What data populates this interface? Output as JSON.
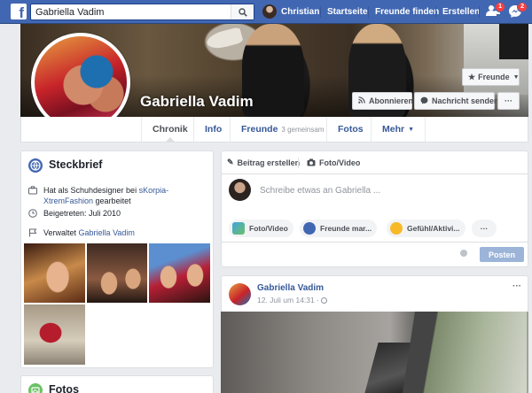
{
  "topbar": {
    "search_value": "Gabriella Vadim",
    "user_name": "Christian",
    "links": [
      "Startseite",
      "Freunde finden",
      "Erstellen"
    ],
    "friend_requests_badge": "1",
    "messages_badge": "2",
    "brand_color": "#4267b2"
  },
  "profile": {
    "name": "Gabriella Vadim",
    "friends_button": "Freunde",
    "subscribe_button": "Abonnieren",
    "message_button": "Nachricht senden",
    "more_button": "···"
  },
  "tabs": {
    "chronik": "Chronik",
    "info": "Info",
    "freunde": "Freunde",
    "freunde_sub": "3 gemeinsam",
    "fotos": "Fotos",
    "mehr": "Mehr"
  },
  "intro": {
    "title": "Steckbrief",
    "job_prefix": "Hat als Schuhdesigner bei",
    "job_company": "sKorpia-XtremFashion",
    "job_suffix": "gearbeitet",
    "joined": "Beigetreten: Juli 2010",
    "manages_prefix": "Verwaltet",
    "manages_name": "Gabriella Vadim"
  },
  "photos_card": {
    "title": "Fotos"
  },
  "composer": {
    "tab_post": "Beitrag erstellen",
    "tab_photo": "Foto/Video",
    "placeholder": "Schreibe etwas an Gabriella ...",
    "pill_photo": "Foto/Video",
    "pill_tag": "Freunde mar...",
    "pill_feeling": "Gefühl/Aktivi...",
    "pill_more": "···",
    "post_button": "Posten"
  },
  "post": {
    "author": "Gabriella Vadim",
    "timestamp": "12. Juli um 14:31 ·",
    "menu": "···"
  }
}
